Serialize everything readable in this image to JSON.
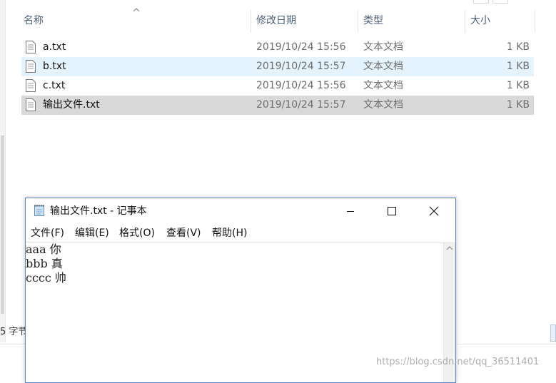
{
  "explorer": {
    "columns": {
      "name": "名称",
      "date": "修改日期",
      "type": "类型",
      "size": "大小"
    },
    "files": [
      {
        "name": "a.txt",
        "date": "2019/10/24 15:56",
        "type": "文本文档",
        "size": "1 KB",
        "state": "normal"
      },
      {
        "name": "b.txt",
        "date": "2019/10/24 15:57",
        "type": "文本文档",
        "size": "1 KB",
        "state": "hover"
      },
      {
        "name": "c.txt",
        "date": "2019/10/24 15:56",
        "type": "文本文档",
        "size": "1 KB",
        "state": "normal"
      },
      {
        "name": "输出文件.txt",
        "date": "2019/10/24 15:57",
        "type": "文本文档",
        "size": "1 KB",
        "state": "selected"
      }
    ],
    "status_text": "5 字节"
  },
  "notepad": {
    "title": "输出文件.txt - 记事本",
    "menu": [
      "文件(F)",
      "编辑(E)",
      "格式(O)",
      "查看(V)",
      "帮助(H)"
    ],
    "lines": [
      "aaa 你",
      "bbb 真",
      "cccc 帅"
    ]
  },
  "watermark": "https://blog.csdn.net/qq_36511401",
  "colors": {
    "hover_row": "#e5f3ff",
    "selected_row": "#d9d9d9",
    "header_text": "#4c607a",
    "window_border": "#5a86c4"
  },
  "icons": [
    "text-file-icon",
    "notepad-app-icon",
    "minimize-icon",
    "maximize-icon",
    "close-icon",
    "sort-up-icon",
    "scroll-up-icon"
  ]
}
